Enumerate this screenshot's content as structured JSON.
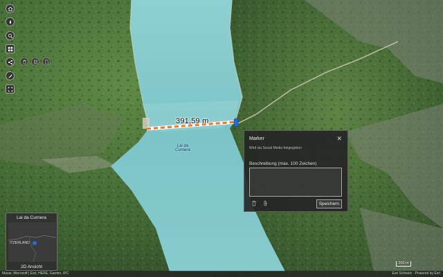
{
  "measurement": {
    "label": "391,59 m"
  },
  "map": {
    "lake_label": "Lai da Curnera",
    "colors": {
      "lake": "#7fc7cc",
      "lake_shallow": "#a6dadc",
      "terrain_dark": "#2e4a2a",
      "terrain_green": "#4f7a3e",
      "rock": "#8b8f86",
      "measure_orange": "#f07a2a",
      "marker_blue": "#1e6fd9"
    }
  },
  "toolbar": {
    "icons": [
      "home-icon",
      "compass-icon",
      "search-icon",
      "basemap-gallery-icon",
      "share-icon",
      "measure-icon",
      "fullscreen-icon"
    ],
    "sub_icons": [
      "trash-icon",
      "layer-icon",
      "document-icon"
    ]
  },
  "popup": {
    "title": "Marker",
    "close": "✕",
    "subtitle": "Wird via Social Media freigegeben",
    "description_label": "Beschreibung (max. 100 Zeichen)",
    "description_value": "",
    "save_label": "Speichern"
  },
  "overview": {
    "title": "Lai da Curnera",
    "country_label": "ITZERLAND",
    "mode_label": "2D Ansicht"
  },
  "attribution": {
    "left": "Maxar, Microsoft | Esri, HERE, Garmin, IPC",
    "right": "Esri Schweiz · Powered by Esri"
  },
  "scale": {
    "label": "200 m"
  }
}
